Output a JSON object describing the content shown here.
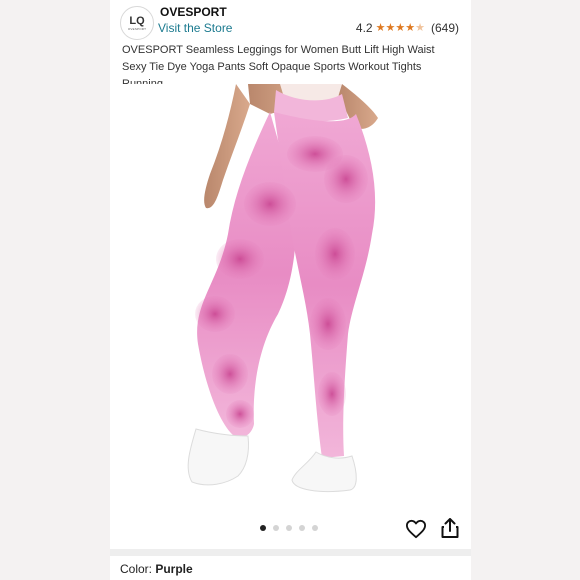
{
  "store": {
    "logo_text": "LQ",
    "logo_subtext": "OVESPORT",
    "name": "OVESPORT",
    "visit_link": "Visit the Store",
    "rating": "4.2",
    "rating_count": "(649)",
    "stars_filled": 4,
    "stars_total": 5,
    "star_icon": "star-icon",
    "accent_color": "#de7921",
    "link_color": "#1b7a8f"
  },
  "product": {
    "title": "OVESPORT Seamless Leggings for Women Butt Lift High Waist Sexy Tie Dye Yoga Pants Soft Opaque Sports Workout Tights Running",
    "image_icon": "product-photo",
    "image_count": 5,
    "active_image": 1,
    "color_label": "Color: ",
    "color_value": "Purple"
  },
  "actions": {
    "heart_icon": "heart-icon",
    "share_icon": "share-icon"
  }
}
